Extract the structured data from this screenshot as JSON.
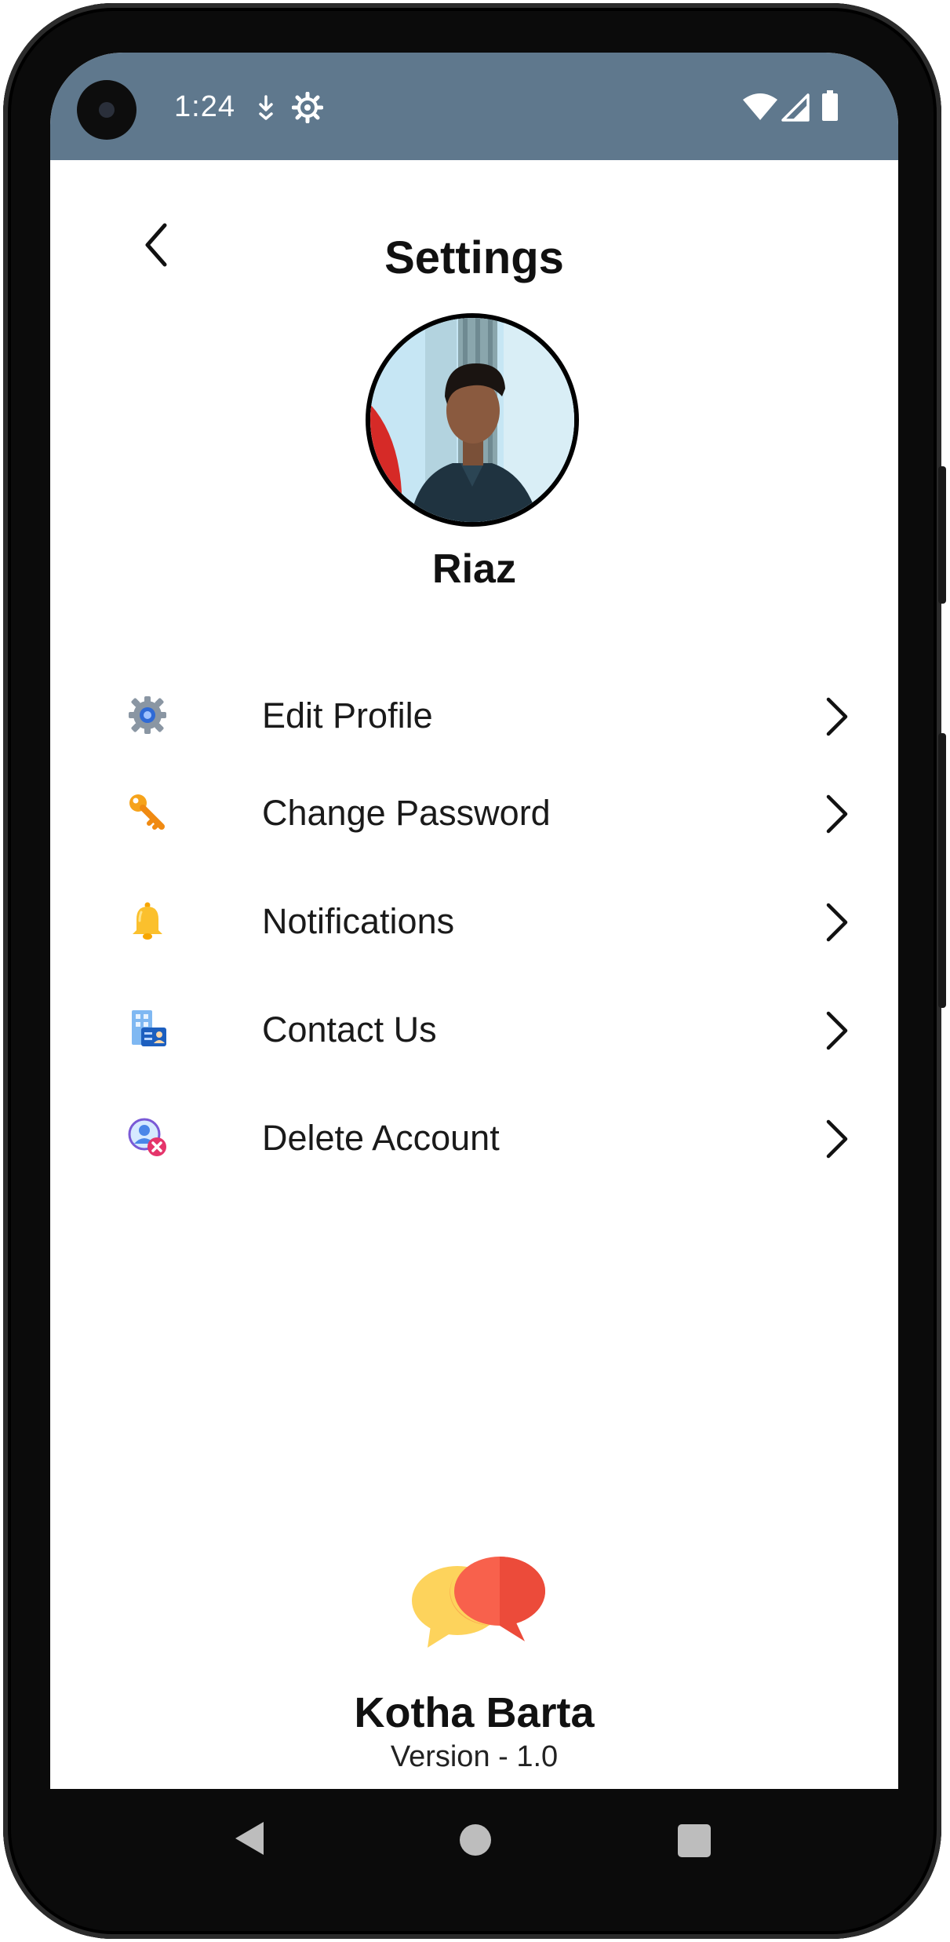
{
  "status_bar": {
    "time": "1:24",
    "icons": [
      "download-arrow-icon",
      "settings-gear-icon",
      "wifi-icon",
      "signal-icon",
      "battery-icon"
    ],
    "background": "#5f788d"
  },
  "header": {
    "title": "Settings",
    "back_icon": "chevron-left-icon"
  },
  "profile": {
    "name": "Riaz"
  },
  "menu": [
    {
      "label": "Edit Profile",
      "icon": "gear-icon"
    },
    {
      "label": "Change Password",
      "icon": "key-icon"
    },
    {
      "label": "Notifications",
      "icon": "bell-icon"
    },
    {
      "label": "Contact Us",
      "icon": "contact-card-icon"
    },
    {
      "label": "Delete Account",
      "icon": "delete-user-icon"
    }
  ],
  "footer": {
    "app_name": "Kotha Barta",
    "version": "Version - 1.0",
    "logo_icon": "chat-bubbles-icon",
    "logo_colors": [
      "#fdd35c",
      "#f8614c"
    ]
  },
  "nav_bar": {
    "icons": [
      "nav-back-icon",
      "nav-home-icon",
      "nav-recents-icon"
    ]
  }
}
